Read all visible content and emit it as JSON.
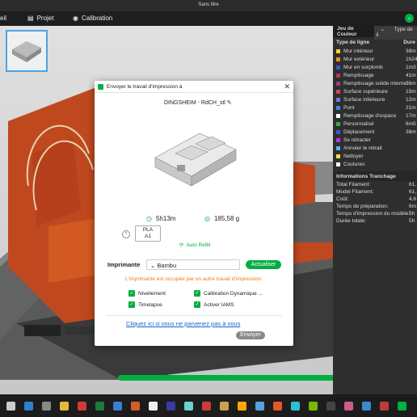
{
  "window": {
    "title": "Sans titre"
  },
  "menu": {
    "item1": "eil",
    "projet": "Projet",
    "calibration": "Calibration"
  },
  "right_panel": {
    "tab_colors": "Jeu de Couleur",
    "tab_type": "Type de li",
    "col_header": "Type de ligne",
    "col_header2": "Dure",
    "lines": [
      {
        "label": "Mur intérieur",
        "value": "38m",
        "color": "#f5cf3b"
      },
      {
        "label": "Mur extérieur",
        "value": "1h24",
        "color": "#ef8a2a"
      },
      {
        "label": "Mur en surplomb",
        "value": "1m3",
        "color": "#3559d6"
      },
      {
        "label": "Remplissage",
        "value": "41m",
        "color": "#b03a55"
      },
      {
        "label": "Remplissage solide interne",
        "value": "36m",
        "color": "#9a3b8e"
      },
      {
        "label": "Surface supérieure",
        "value": "15m",
        "color": "#cc4a53"
      },
      {
        "label": "Surface inférieure",
        "value": "12m",
        "color": "#6778e0"
      },
      {
        "label": "Pont",
        "value": "21m",
        "color": "#3a8fd0"
      },
      {
        "label": "Remplissage d'espace",
        "value": "17m",
        "color": "#ffffff"
      },
      {
        "label": "Personnalisé",
        "value": "6m5",
        "color": "#3aaa4a"
      },
      {
        "label": "Déplacement",
        "value": "38m",
        "color": "#3a5cd8"
      },
      {
        "label": "Se rétracter",
        "value": "",
        "color": "#b03ad6"
      },
      {
        "label": "Annuler le retrait",
        "value": "",
        "color": "#5ab0ff"
      },
      {
        "label": "Nettoyer",
        "value": "",
        "color": "#f0e040"
      },
      {
        "label": "Coutures",
        "value": "",
        "color": "#ffffff"
      }
    ],
    "info_title": "Informations Tranchage",
    "info": [
      {
        "label": "Total Filament:",
        "value": "61,"
      },
      {
        "label": "Model Filament:",
        "value": "61,"
      },
      {
        "label": "Coût:",
        "value": "4,6"
      },
      {
        "label": "Temps de préparation:",
        "value": "6m"
      },
      {
        "label": "Temps d'impression du modèle:",
        "value": "5h"
      },
      {
        "label": "Durée totale:",
        "value": "5h"
      }
    ]
  },
  "dialog": {
    "title": "Envoyer le travail d'impression à",
    "file_name": "DINGSHEIM - RdCH_stl",
    "time": "5h13m",
    "weight": "185,58 g",
    "filament_type": "PLA",
    "filament_slot": "A1",
    "auto_refill": "Auto Refill",
    "printer_label": "Imprimante",
    "printer_value": "Bambu",
    "refresh": "Actualiser",
    "busy_warning": "L'imprimante est occupée par un autre travail d'impression.",
    "options": {
      "leveling": "Nivellement",
      "calibration": "Calibration Dynamique ...",
      "timelapse": "Timelapse",
      "ams": "Activer IAMS"
    },
    "help_link": "Cliquez ici si vous ne parvenez pas à vous",
    "send": "Envoyer"
  },
  "colors": {
    "accent": "#00ae42",
    "warning": "#f07a17",
    "link": "#1a5fd0"
  }
}
